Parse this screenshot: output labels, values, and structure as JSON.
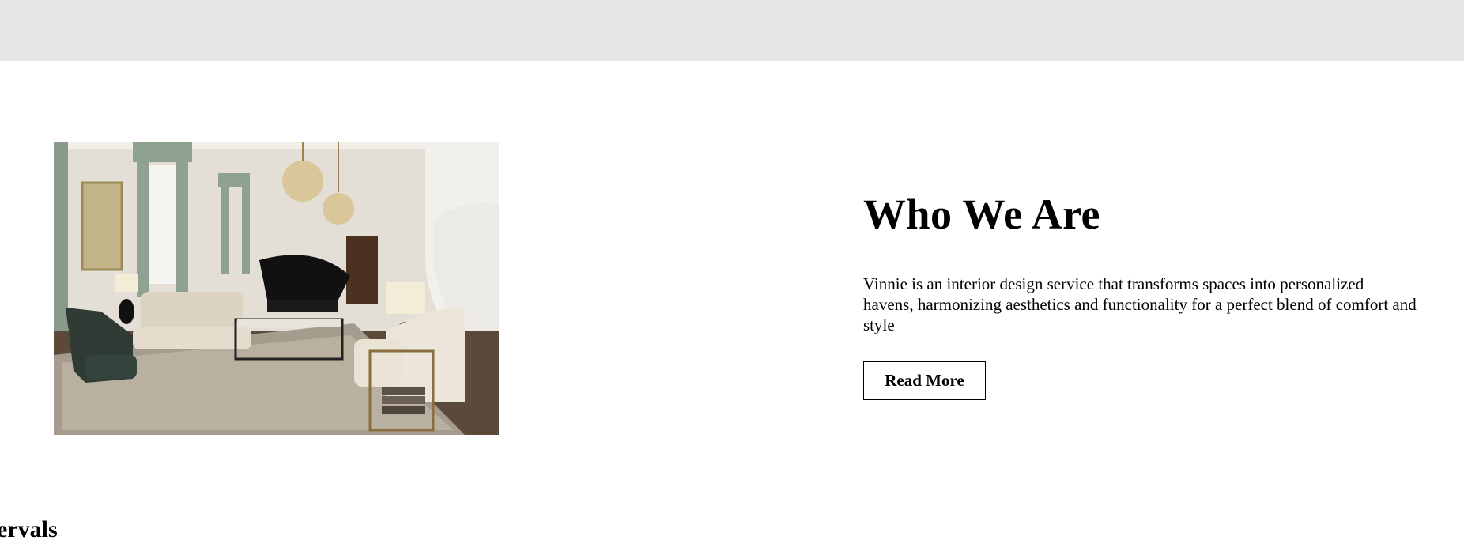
{
  "about": {
    "title": "Who We Are",
    "description": "Vinnie is an interior design service that transforms spaces into personalized havens, harmonizing aesthetics and functionality for a perfect blend of comfort and style",
    "button_label": "Read More"
  },
  "next_section": {
    "heading_partial": "ervals"
  },
  "colors": {
    "top_band": "#e6e6e6",
    "background": "#ffffff",
    "text": "#000000"
  }
}
